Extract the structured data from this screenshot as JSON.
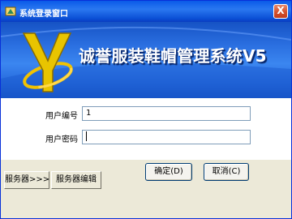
{
  "window": {
    "title": "系统登录窗口",
    "close_label": "X"
  },
  "banner": {
    "title": "诚誉服装鞋帽管理系统V5",
    "logo_letter": "Y"
  },
  "form": {
    "user_id_label": "用户编号",
    "user_id_value": "1",
    "password_label": "用户密码",
    "password_value": ""
  },
  "buttons": {
    "server_toggle": "服务器>>>",
    "server_edit": "服务器编辑",
    "confirm": "确定(D)",
    "cancel": "取消(C)"
  },
  "colors": {
    "titlebar": "#0a5ae8",
    "banner": "#2a6fe0",
    "window_bg": "#ece9d8",
    "close_button": "#d4512c"
  }
}
